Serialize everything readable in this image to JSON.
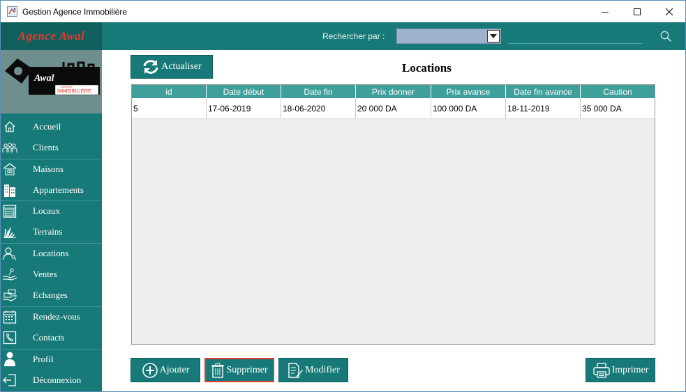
{
  "window": {
    "title": "Gestion Agence Immobilière"
  },
  "topbar": {
    "brand": "Agence Awal",
    "search_label": "Rechercher par :",
    "search_select_value": "",
    "search_value": ""
  },
  "sidebar": {
    "logo_text": "Awal",
    "logo_sub1": "AGENCE",
    "logo_sub2": "IMMOBILIÈRE",
    "items": [
      {
        "label": "Accueil",
        "icon": "home-icon"
      },
      {
        "label": "Clients",
        "icon": "people-icon"
      },
      {
        "label": "Maisons",
        "icon": "house-icon"
      },
      {
        "label": "Appartements",
        "icon": "building-icon"
      },
      {
        "label": "Locaux",
        "icon": "store-icon"
      },
      {
        "label": "Terrains",
        "icon": "grass-icon"
      },
      {
        "label": "Locations",
        "icon": "user-key-icon"
      },
      {
        "label": "Ventes",
        "icon": "hand-key-icon"
      },
      {
        "label": "Echanges",
        "icon": "exchange-icon"
      },
      {
        "label": "Rendez-vous",
        "icon": "calendar-icon"
      },
      {
        "label": "Contacts",
        "icon": "phone-icon"
      },
      {
        "label": "Profil",
        "icon": "user-icon"
      },
      {
        "label": "Déconnexion",
        "icon": "logout-icon"
      }
    ]
  },
  "main": {
    "refresh_label": "Actualiser",
    "title": "Locations",
    "add_label": "Ajouter",
    "delete_label": "Supprimer",
    "edit_label": "Modifier",
    "print_label": "Imprimer"
  },
  "table": {
    "columns": [
      "id",
      "Date début",
      "Date fin",
      "Prix donner",
      "Prix avance",
      "Date fin avance",
      "Caution"
    ],
    "rows": [
      [
        "5",
        "17-06-2019",
        "18-06-2020",
        "20 000 DA",
        "100 000 DA",
        "18-11-2019",
        "35 000 DA"
      ]
    ]
  },
  "colors": {
    "primary": "#177a78",
    "dark": "#0f5f5d",
    "header": "#3f9f9b",
    "brand_text": "#e33b2d",
    "danger_border": "#e33b2d"
  }
}
